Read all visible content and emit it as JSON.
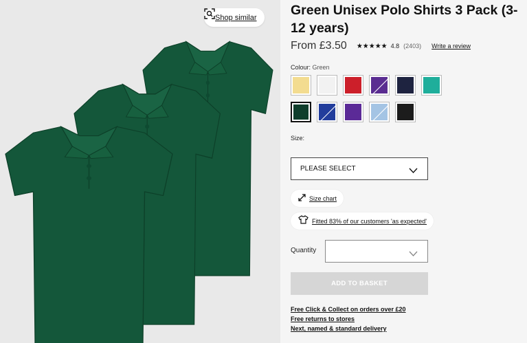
{
  "gallery": {
    "shop_similar": {
      "label": "Shop similar",
      "icon": "visual-search-icon"
    },
    "product_color": "#14573a"
  },
  "product": {
    "title": "Green Unisex Polo Shirts 3 Pack (3-12 years)",
    "price": "From £3.50",
    "stars": "★★★★★",
    "rating": "4.8",
    "review_count": "(2403)",
    "write_review": "Write a review"
  },
  "colour": {
    "label": "Colour:",
    "selected": "Green",
    "swatches": [
      {
        "name": "yellow",
        "color": "#f3dc90",
        "diagonal": false,
        "selected": false
      },
      {
        "name": "white",
        "color": "#f2f2f2",
        "diagonal": false,
        "selected": false
      },
      {
        "name": "red",
        "color": "#cc1f2a",
        "diagonal": false,
        "selected": false
      },
      {
        "name": "purple",
        "color": "#5a2d91",
        "diagonal": true,
        "selected": false
      },
      {
        "name": "navy",
        "color": "#1e2340",
        "diagonal": false,
        "selected": false
      },
      {
        "name": "jade",
        "color": "#1fae9b",
        "diagonal": false,
        "selected": false
      },
      {
        "name": "green",
        "color": "#0f3e2c",
        "diagonal": false,
        "selected": true
      },
      {
        "name": "royal-blue",
        "color": "#223d9c",
        "diagonal": true,
        "selected": false
      },
      {
        "name": "violet",
        "color": "#5b2a97",
        "diagonal": false,
        "selected": false
      },
      {
        "name": "light-blue",
        "color": "#a4c4e4",
        "diagonal": true,
        "selected": false
      },
      {
        "name": "black",
        "color": "#1c1c1c",
        "diagonal": false,
        "selected": false
      }
    ]
  },
  "size": {
    "label": "Size:",
    "placeholder": "PLEASE SELECT"
  },
  "size_chart": {
    "label": "Size chart",
    "icon": "expand-arrows-icon"
  },
  "fit": {
    "label": "Fitted 83% of our customers 'as expected'",
    "icon": "tshirt-icon"
  },
  "quantity": {
    "label": "Quantity",
    "value": ""
  },
  "basket": {
    "label": "ADD TO BASKET",
    "disabled": true
  },
  "delivery_links": [
    "Free Click & Collect on orders over £20",
    "Free returns to stores",
    "Next, named & standard delivery"
  ]
}
